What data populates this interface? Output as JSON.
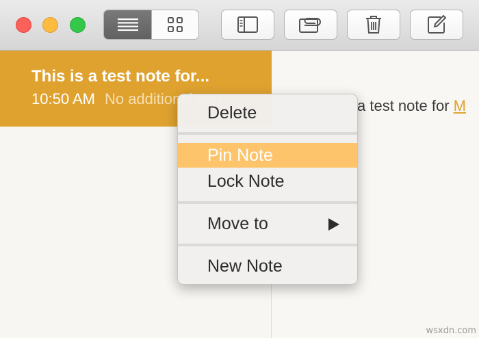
{
  "toolbar": {
    "traffic_lights": [
      "close",
      "minimize",
      "maximize"
    ],
    "view_modes": [
      {
        "icon": "list-view-icon",
        "active": true
      },
      {
        "icon": "gallery-view-icon",
        "active": false
      }
    ],
    "buttons": [
      {
        "icon": "sidebar-toggle-icon"
      },
      {
        "icon": "attachments-icon"
      },
      {
        "icon": "trash-icon"
      },
      {
        "icon": "compose-icon"
      }
    ]
  },
  "note_list": {
    "selected_note": {
      "title": "This is a test note for...",
      "time": "10:50 AM",
      "preview": "No additional text",
      "color": "#dfa22f"
    }
  },
  "editor": {
    "text": "a test note for ",
    "link_text": "M"
  },
  "context_menu": {
    "items": [
      {
        "label": "Delete"
      },
      {
        "label": "Pin Note",
        "highlighted": true
      },
      {
        "label": "Lock Note"
      },
      {
        "label": "Move to",
        "submenu": true
      },
      {
        "label": "New Note"
      }
    ],
    "highlight_color": "#fdc46b"
  },
  "watermark": "wsxdn.com"
}
